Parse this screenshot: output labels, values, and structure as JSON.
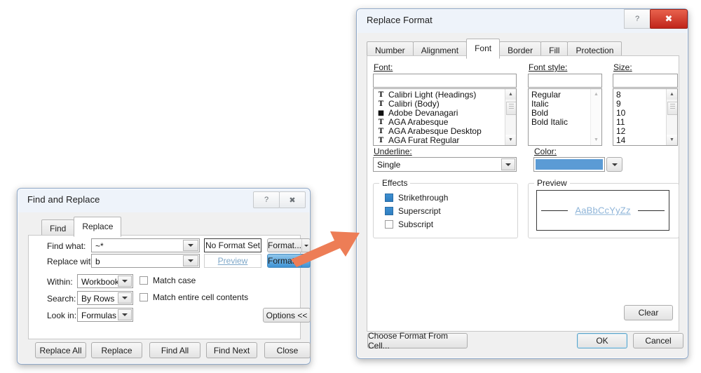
{
  "find_replace": {
    "title": "Find and Replace",
    "titlebar_buttons": [
      {
        "name": "help-button",
        "glyph": "?"
      },
      {
        "name": "close-button",
        "glyph": "✖"
      }
    ],
    "tabs": [
      {
        "label": "Find",
        "active": false
      },
      {
        "label": "Replace",
        "active": true
      }
    ],
    "find_what_label": "Find what:",
    "find_what_value": "~*",
    "replace_with_label": "Replace with:",
    "replace_with_value": "b",
    "no_format_set_label": "No Format Set",
    "preview_label": "Preview",
    "format_button_1": "Format...",
    "format_button_2": "Format...",
    "within_label": "Within:",
    "within_value": "Workbook",
    "search_label": "Search:",
    "search_value": "By Rows",
    "look_in_label": "Look in:",
    "look_in_value": "Formulas",
    "match_case_label": "Match case",
    "match_entire_label": "Match entire cell contents",
    "options_button": "Options <<",
    "footer_buttons": [
      "Replace All",
      "Replace",
      "Find All",
      "Find Next",
      "Close"
    ]
  },
  "replace_format": {
    "title": "Replace Format",
    "titlebar_buttons": [
      {
        "name": "help-button",
        "glyph": "?"
      },
      {
        "name": "close-button",
        "glyph": "✖"
      }
    ],
    "tabs": [
      {
        "label": "Number",
        "active": false
      },
      {
        "label": "Alignment",
        "active": false
      },
      {
        "label": "Font",
        "active": true
      },
      {
        "label": "Border",
        "active": false
      },
      {
        "label": "Fill",
        "active": false
      },
      {
        "label": "Protection",
        "active": false
      }
    ],
    "font_label": "Font:",
    "font_value": "",
    "font_list": [
      {
        "text": "Calibri Light (Headings)",
        "icon": "truetype-icon"
      },
      {
        "text": "Calibri (Body)",
        "icon": "truetype-icon"
      },
      {
        "text": "Adobe Devanagari",
        "icon": "opentype-icon"
      },
      {
        "text": "AGA Arabesque",
        "icon": "truetype-icon"
      },
      {
        "text": "AGA Arabesque Desktop",
        "icon": "truetype-icon"
      },
      {
        "text": "AGA Furat Regular",
        "icon": "truetype-icon"
      }
    ],
    "font_style_label": "Font style:",
    "font_style_value": "",
    "font_style_list": [
      "Regular",
      "Italic",
      "Bold",
      "Bold Italic"
    ],
    "size_label": "Size:",
    "size_value": "",
    "size_list": [
      "8",
      "9",
      "10",
      "11",
      "12",
      "14"
    ],
    "underline_label": "Underline:",
    "underline_value": "Single",
    "color_label": "Color:",
    "color_value": "#5B9BD5",
    "effects_label": "Effects",
    "effects": [
      {
        "label": "Strikethrough",
        "state": "filled"
      },
      {
        "label": "Superscript",
        "state": "filled"
      },
      {
        "label": "Subscript",
        "state": "unchecked"
      }
    ],
    "preview_label": "Preview",
    "preview_text": "AaBbCcYyZz",
    "clear_button": "Clear",
    "choose_format_button": "Choose Format From Cell...",
    "ok_button": "OK",
    "cancel_button": "Cancel"
  },
  "annotation": {
    "arrow_color": "#ED7D56"
  }
}
